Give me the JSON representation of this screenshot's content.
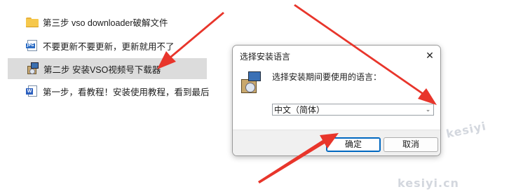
{
  "explorer": {
    "files": [
      {
        "name": "第三步 vso downloader破解文件",
        "icon": "folder-icon"
      },
      {
        "name": "不要更新不要更新，更新就用不了",
        "icon": "jpg-icon"
      },
      {
        "name": "第二步   安装VSO视频号下载器",
        "icon": "setup-icon",
        "selected": true
      },
      {
        "name": "第一步，看教程！安装使用教程，看到最后",
        "icon": "word-doc-icon"
      }
    ]
  },
  "dialog": {
    "title": "选择安装语言",
    "close_glyph": "✕",
    "prompt": "选择安装期间要使用的语言：",
    "language_selected": "中文（简体）",
    "chevron_glyph": "⌄",
    "ok_label": "确定",
    "cancel_label": "取消"
  },
  "watermark": {
    "text1": "kesiyi",
    "text2": "kesiyi.cn"
  },
  "annotation_color": "#e8352b"
}
